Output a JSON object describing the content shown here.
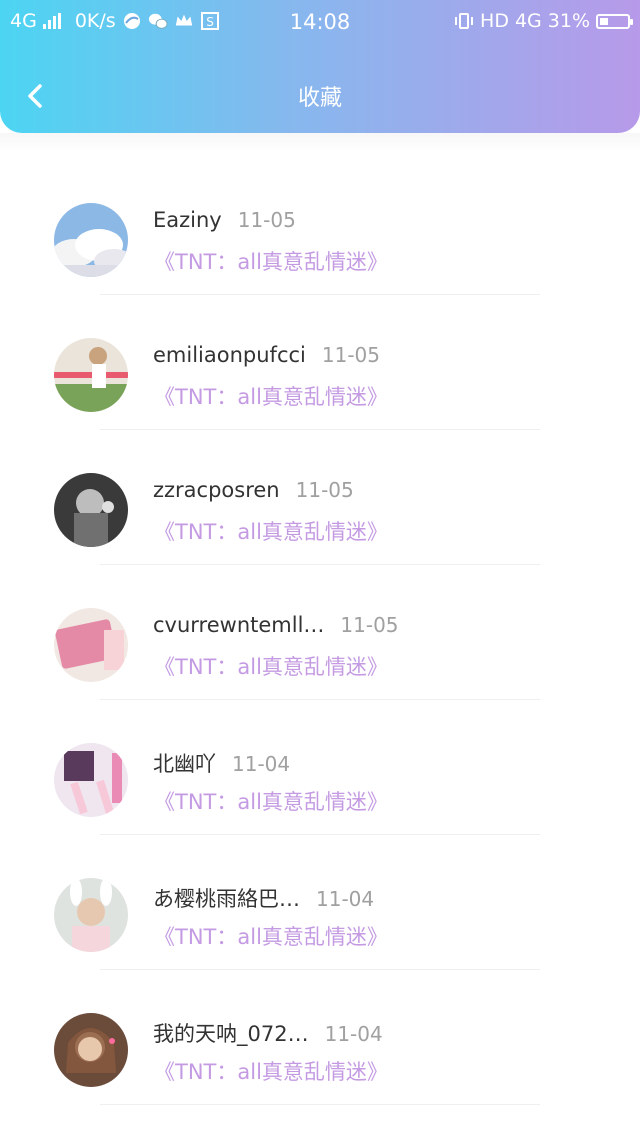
{
  "status_bar": {
    "network": "4G",
    "speed": "0K/s",
    "time": "14:08",
    "hd": "HD",
    "net2": "4G",
    "battery": "31%",
    "battery_level": 0.31
  },
  "header": {
    "title": "收藏"
  },
  "items": [
    {
      "name": "Eaziny",
      "date": "11-05",
      "book": "《TNT：all真意乱情迷》",
      "avatar_icon": "sky-clouds-avatar"
    },
    {
      "name": "emiliaonpufcci",
      "date": "11-05",
      "book": "《TNT：all真意乱情迷》",
      "avatar_icon": "girl-outdoor-avatar"
    },
    {
      "name": "zzracposren",
      "date": "11-05",
      "book": "《TNT：all真意乱情迷》",
      "avatar_icon": "bw-portrait-avatar"
    },
    {
      "name": "cvurrewntemll…",
      "date": "11-05",
      "book": "《TNT：all真意乱情迷》",
      "avatar_icon": "pink-notebook-avatar"
    },
    {
      "name": "北幽吖",
      "date": "11-04",
      "book": "《TNT：all真意乱情迷》",
      "avatar_icon": "pink-legs-avatar"
    },
    {
      "name": "あ樱桃雨絡巴…",
      "date": "11-04",
      "book": "《TNT：all真意乱情迷》",
      "avatar_icon": "bunny-ears-avatar"
    },
    {
      "name": "我的天呐_072…",
      "date": "11-04",
      "book": "《TNT：all真意乱情迷》",
      "avatar_icon": "hermione-avatar"
    }
  ]
}
